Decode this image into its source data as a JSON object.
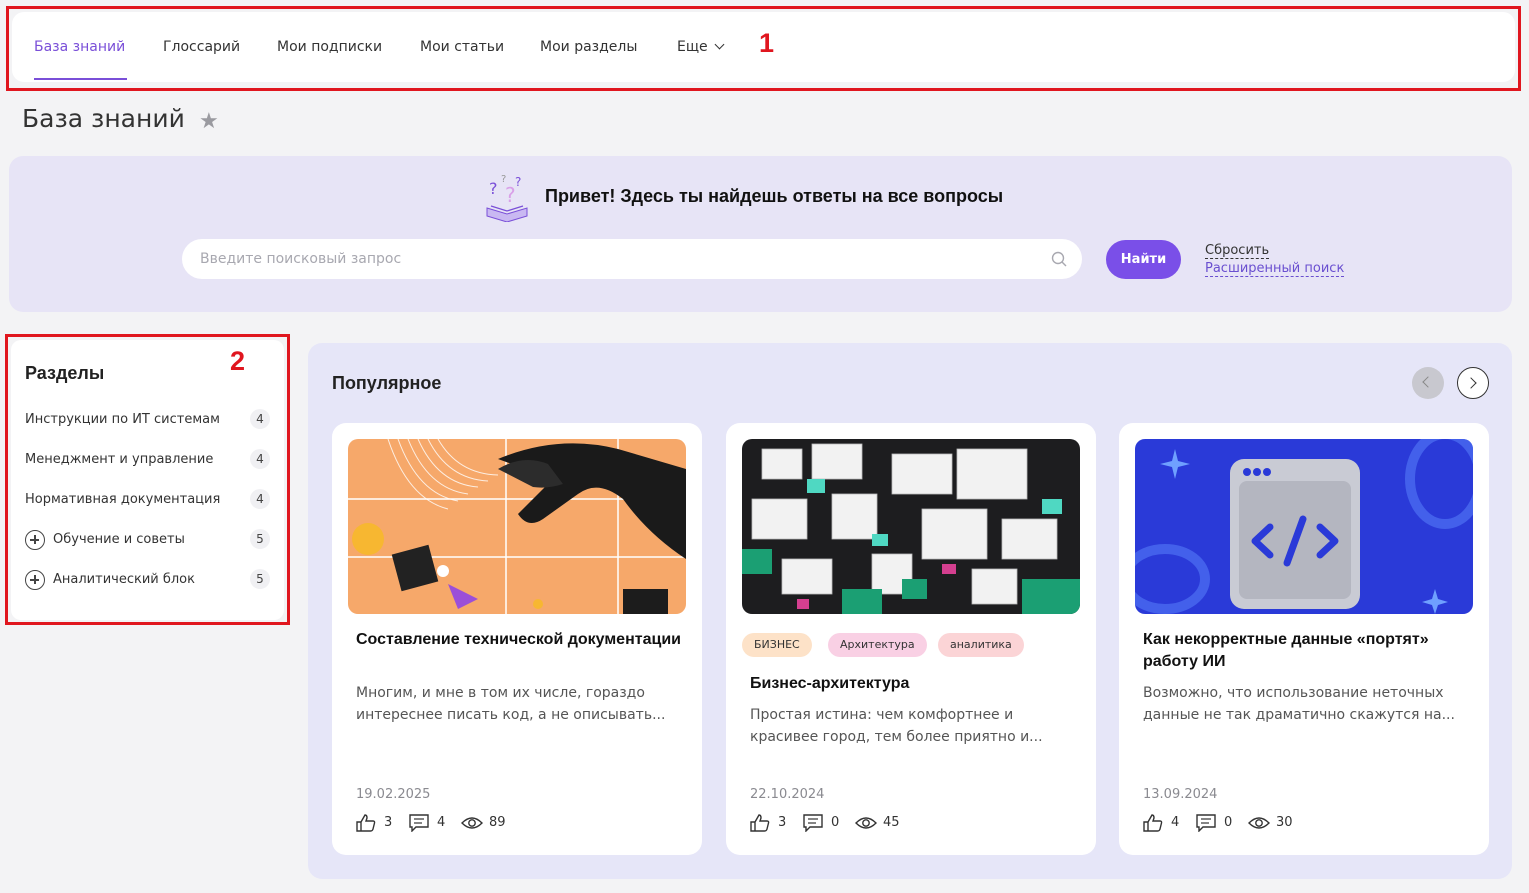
{
  "nav": {
    "items": [
      "База знаний",
      "Глоссарий",
      "Мои подписки",
      "Мои статьи",
      "Мои разделы"
    ],
    "more_label": "Еще",
    "active_index": 0
  },
  "markers": {
    "nav": "1",
    "sidebar": "2"
  },
  "page": {
    "title": "База знаний"
  },
  "hero": {
    "title": "Привет! Здесь ты найдешь ответы на все вопросы",
    "search_placeholder": "Введите поисковый запрос",
    "search_value": "",
    "find_button": "Найти",
    "reset_link": "Сбросить",
    "advanced_link": "Расширенный поиск"
  },
  "sidebar": {
    "title": "Разделы",
    "items": [
      {
        "label": "Инструкции по ИТ системам",
        "count": "4",
        "expandable": false
      },
      {
        "label": "Менеджмент и управление",
        "count": "4",
        "expandable": false
      },
      {
        "label": "Нормативная документация",
        "count": "4",
        "expandable": false
      },
      {
        "label": "Обучение и советы",
        "count": "5",
        "expandable": true
      },
      {
        "label": "Аналитический блок",
        "count": "5",
        "expandable": true
      }
    ]
  },
  "popular": {
    "title": "Популярное",
    "cards": [
      {
        "title": "Составление технической документации",
        "description": "Многим, и мне в том их числе, гораздо интереснее писать код, а не описывать...",
        "tags": [],
        "date": "19.02.2025",
        "likes": "3",
        "comments": "4",
        "views": "89"
      },
      {
        "title": "Бизнес-архитектура",
        "description": "Простая истина: чем комфортнее и красивее город, тем более приятно и...",
        "tags": [
          "БИЗНЕС",
          "Архитектура",
          "аналитика"
        ],
        "date": "22.10.2024",
        "likes": "3",
        "comments": "0",
        "views": "45"
      },
      {
        "title": "Как некорректные данные «портят» работу ИИ",
        "description": "Возможно, что использование неточных данные не так драматично скажутся на...",
        "tags": [],
        "date": "13.09.2024",
        "likes": "4",
        "comments": "0",
        "views": "30"
      }
    ]
  },
  "colors": {
    "accent": "#7a4fe8",
    "highlight_frame": "#e0161f",
    "hero_bg": "#e7e4f6",
    "panel_bg": "#e6e6f8"
  }
}
